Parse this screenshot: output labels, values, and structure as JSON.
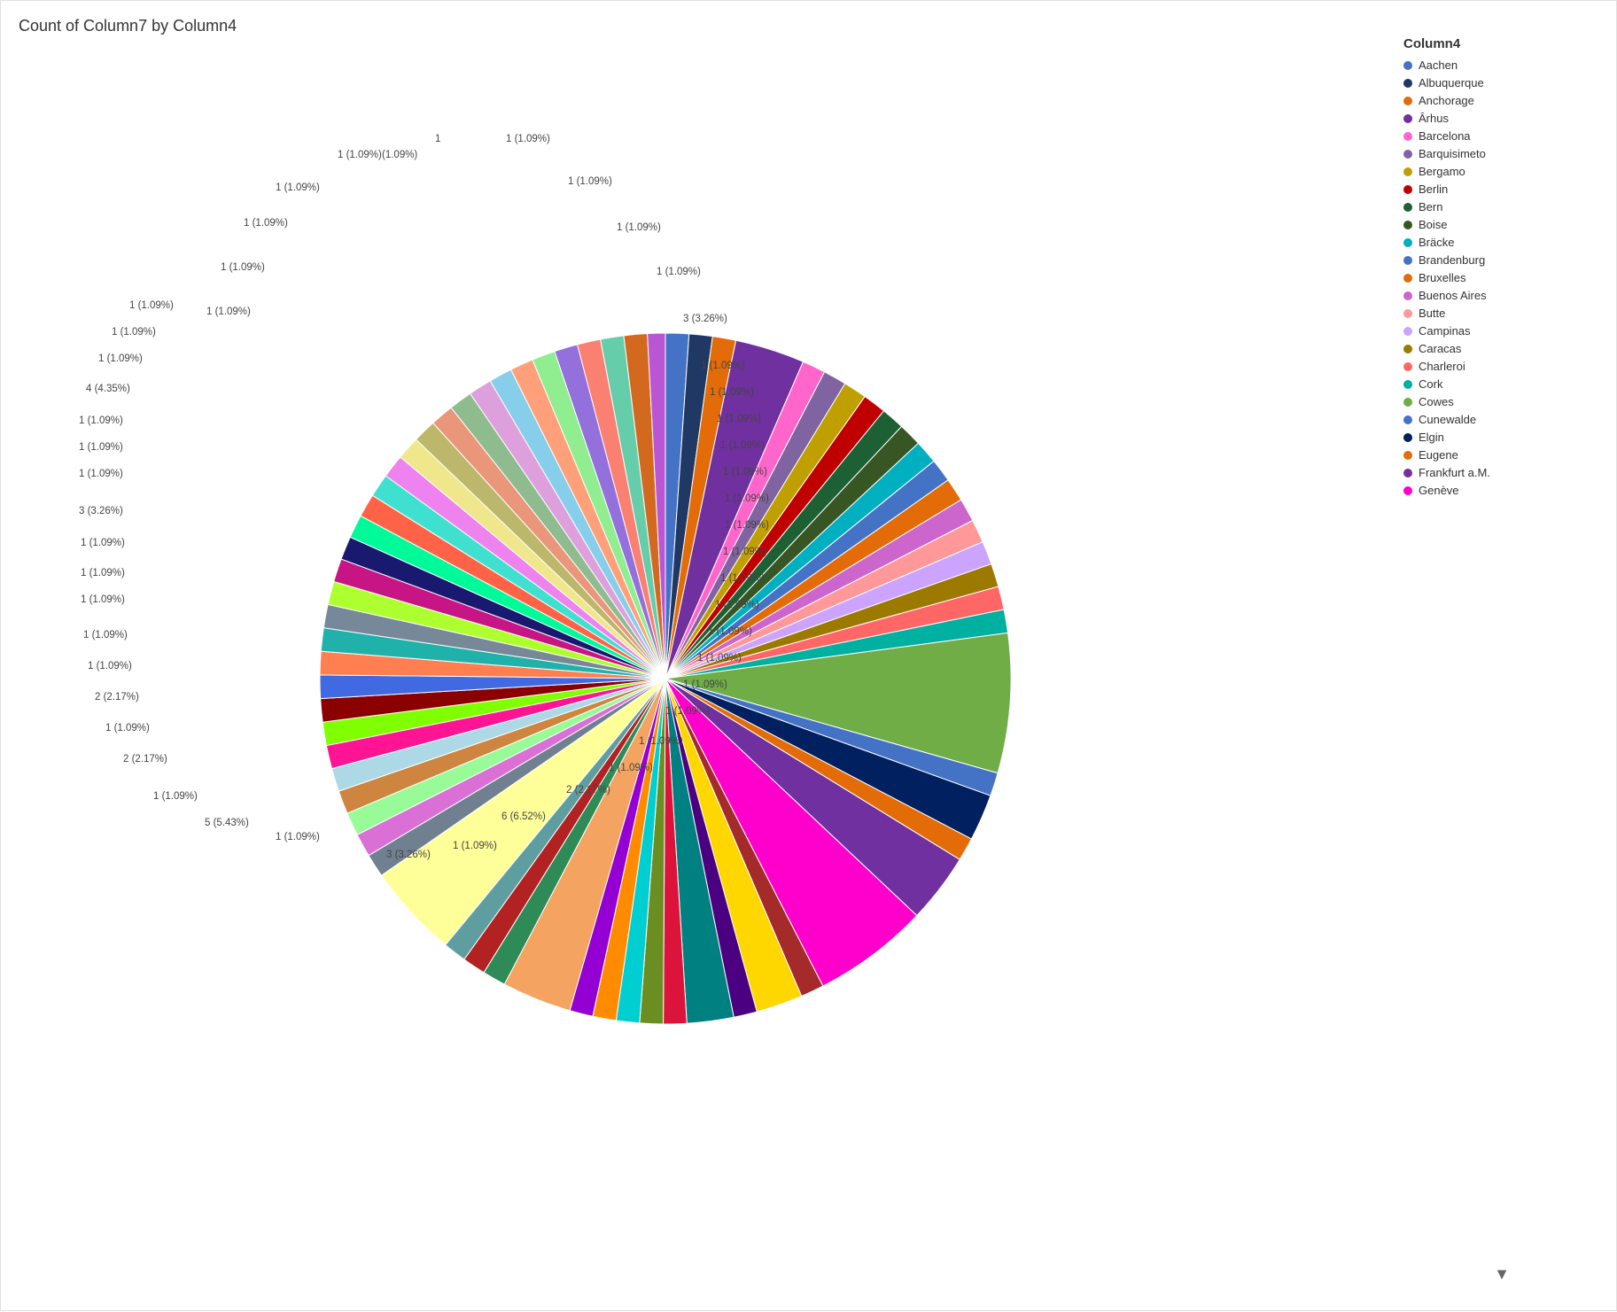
{
  "title": "Count of Column7 by Column4",
  "legend": {
    "title": "Column4",
    "items": [
      {
        "label": "Aachen",
        "color": "#4472C4"
      },
      {
        "label": "Albuquerque",
        "color": "#1F3864"
      },
      {
        "label": "Anchorage",
        "color": "#E36C09"
      },
      {
        "label": "Ārhus",
        "color": "#7030A0"
      },
      {
        "label": "Barcelona",
        "color": "#FF66CC"
      },
      {
        "label": "Barquisimeto",
        "color": "#8064A2"
      },
      {
        "label": "Bergamo",
        "color": "#C0A000"
      },
      {
        "label": "Berlin",
        "color": "#C00000"
      },
      {
        "label": "Bern",
        "color": "#1D6033"
      },
      {
        "label": "Boise",
        "color": "#375623"
      },
      {
        "label": "Bräcke",
        "color": "#00B0C0"
      },
      {
        "label": "Brandenburg",
        "color": "#4472C4"
      },
      {
        "label": "Bruxelles",
        "color": "#E36C09"
      },
      {
        "label": "Buenos Aires",
        "color": "#CC66CC"
      },
      {
        "label": "Butte",
        "color": "#FF9999"
      },
      {
        "label": "Campinas",
        "color": "#CCA3FF"
      },
      {
        "label": "Caracas",
        "color": "#9C7A00"
      },
      {
        "label": "Charleroi",
        "color": "#FF6666"
      },
      {
        "label": "Cork",
        "color": "#00B0A0"
      },
      {
        "label": "Cowes",
        "color": "#70AD47"
      },
      {
        "label": "Cunewalde",
        "color": "#4472C4"
      },
      {
        "label": "Elgin",
        "color": "#002060"
      },
      {
        "label": "Eugene",
        "color": "#E36C09"
      },
      {
        "label": "Frankfurt a.M.",
        "color": "#7030A0"
      },
      {
        "label": "Genève",
        "color": "#FF00CC"
      }
    ]
  },
  "slices": [
    {
      "label": "1 (1.09%)",
      "color": "#4472C4",
      "startAngle": 0,
      "endAngle": 3.927
    },
    {
      "label": "1 (1.09%)",
      "color": "#1F3864",
      "startAngle": 3.927,
      "endAngle": 7.854
    },
    {
      "label": "1 (1.09%)",
      "color": "#E36C09",
      "startAngle": 7.854,
      "endAngle": 11.781
    },
    {
      "label": "3 (3.26%)",
      "color": "#7030A0",
      "startAngle": 11.781,
      "endAngle": 23.491
    },
    {
      "label": "1 (1.09%)",
      "color": "#FF66CC",
      "startAngle": 23.491,
      "endAngle": 27.418
    },
    {
      "label": "1 (1.09%)",
      "color": "#8064A2",
      "startAngle": 27.418,
      "endAngle": 31.345
    },
    {
      "label": "1 (1.09%)",
      "color": "#C0A000",
      "startAngle": 31.345,
      "endAngle": 35.272
    },
    {
      "label": "1 (1.09%)",
      "color": "#C00000",
      "startAngle": 35.272,
      "endAngle": 39.199
    },
    {
      "label": "1 (1.09%)",
      "color": "#1D6033",
      "startAngle": 39.199,
      "endAngle": 43.126
    },
    {
      "label": "1 (1.09%)",
      "color": "#375623",
      "startAngle": 43.126,
      "endAngle": 47.053
    },
    {
      "label": "1 (1.09%)",
      "color": "#00B0C0",
      "startAngle": 47.053,
      "endAngle": 50.98
    },
    {
      "label": "1 (1.09%)",
      "color": "#4472C4",
      "startAngle": 50.98,
      "endAngle": 54.907
    },
    {
      "label": "1 (1.09%)",
      "color": "#E36C09",
      "startAngle": 54.907,
      "endAngle": 58.834
    },
    {
      "label": "1 (1.09%)",
      "color": "#CC66CC",
      "startAngle": 58.834,
      "endAngle": 62.761
    },
    {
      "label": "1 (1.09%)",
      "color": "#FF9999",
      "startAngle": 62.761,
      "endAngle": 66.688
    },
    {
      "label": "1 (1.09%)",
      "color": "#CCA3FF",
      "startAngle": 66.688,
      "endAngle": 70.615
    },
    {
      "label": "1 (1.09%)",
      "color": "#9C7A00",
      "startAngle": 70.615,
      "endAngle": 74.542
    },
    {
      "label": "1 (1.09%)",
      "color": "#FF6666",
      "startAngle": 74.542,
      "endAngle": 78.469
    },
    {
      "label": "1 (1.09%)",
      "color": "#00B0A0",
      "startAngle": 78.469,
      "endAngle": 82.396
    },
    {
      "label": "6 (6.52%)",
      "color": "#70AD47",
      "startAngle": 82.396,
      "endAngle": 105.887
    },
    {
      "label": "1 (1.09%)",
      "color": "#4472C4",
      "startAngle": 105.887,
      "endAngle": 109.814
    },
    {
      "label": "2 (2.17%)",
      "color": "#002060",
      "startAngle": 109.814,
      "endAngle": 117.668
    },
    {
      "label": "1 (1.09%)",
      "color": "#E36C09",
      "startAngle": 117.668,
      "endAngle": 121.595
    },
    {
      "label": "3 (3.26%)",
      "color": "#7030A0",
      "startAngle": 121.595,
      "endAngle": 133.305
    },
    {
      "label": "5 (5.43%)",
      "color": "#FF00CC",
      "startAngle": 133.305,
      "endAngle": 152.868
    },
    {
      "label": "1 (1.09%)",
      "color": "#A52A2A",
      "startAngle": 152.868,
      "endAngle": 156.795
    },
    {
      "label": "2 (2.17%)",
      "color": "#FFD700",
      "startAngle": 156.795,
      "endAngle": 164.649
    },
    {
      "label": "1 (1.09%)",
      "color": "#4B0082",
      "startAngle": 164.649,
      "endAngle": 168.576
    },
    {
      "label": "2 (2.17%)",
      "color": "#008080",
      "startAngle": 168.576,
      "endAngle": 176.43
    },
    {
      "label": "1 (1.09%)",
      "color": "#DC143C",
      "startAngle": 176.43,
      "endAngle": 180.357
    },
    {
      "label": "1 (1.09%)",
      "color": "#6B8E23",
      "startAngle": 180.357,
      "endAngle": 184.284
    },
    {
      "label": "1 (1.09%)",
      "color": "#00CED1",
      "startAngle": 184.284,
      "endAngle": 188.211
    },
    {
      "label": "1 (1.09%)",
      "color": "#FF8C00",
      "startAngle": 188.211,
      "endAngle": 192.138
    },
    {
      "label": "1 (1.09%)",
      "color": "#9400D3",
      "startAngle": 192.138,
      "endAngle": 196.065
    },
    {
      "label": "3 (3.26%)",
      "color": "#F4A460",
      "startAngle": 196.065,
      "endAngle": 207.775
    },
    {
      "label": "1 (1.09%)",
      "color": "#2E8B57",
      "startAngle": 207.775,
      "endAngle": 211.702
    },
    {
      "label": "1 (1.09%)",
      "color": "#B22222",
      "startAngle": 211.702,
      "endAngle": 215.629
    },
    {
      "label": "1 (1.09%)",
      "color": "#5F9EA0",
      "startAngle": 215.629,
      "endAngle": 219.556
    },
    {
      "label": "4 (4.35%)",
      "color": "#FFFF99",
      "startAngle": 219.556,
      "endAngle": 235.266
    },
    {
      "label": "1 (1.09%)",
      "color": "#708090",
      "startAngle": 235.266,
      "endAngle": 239.193
    },
    {
      "label": "1 (1.09%)",
      "color": "#DA70D6",
      "startAngle": 239.193,
      "endAngle": 243.12
    },
    {
      "label": "1 (1.09%)",
      "color": "#98FB98",
      "startAngle": 243.12,
      "endAngle": 247.047
    },
    {
      "label": "1 (1.09%)",
      "color": "#CD853F",
      "startAngle": 247.047,
      "endAngle": 250.974
    },
    {
      "label": "1 (1.09%)",
      "color": "#ADD8E6",
      "startAngle": 250.974,
      "endAngle": 254.901
    },
    {
      "label": "1 (1.09%)",
      "color": "#FF1493",
      "startAngle": 254.901,
      "endAngle": 258.828
    },
    {
      "label": "1 (1.09%)",
      "color": "#7FFF00",
      "startAngle": 258.828,
      "endAngle": 262.755
    },
    {
      "label": "1 (1.09%)",
      "color": "#8B0000",
      "startAngle": 262.755,
      "endAngle": 266.682
    },
    {
      "label": "1 (1.09%)",
      "color": "#4169E1",
      "startAngle": 266.682,
      "endAngle": 270.609
    },
    {
      "label": "1 (1.09%)",
      "color": "#FF7F50",
      "startAngle": 270.609,
      "endAngle": 274.536
    },
    {
      "label": "1 (1.09%)",
      "color": "#20B2AA",
      "startAngle": 274.536,
      "endAngle": 278.463
    },
    {
      "label": "1 (1.09%)",
      "color": "#778899",
      "startAngle": 278.463,
      "endAngle": 282.39
    },
    {
      "label": "1 (1.09%)",
      "color": "#ADFF2F",
      "startAngle": 282.39,
      "endAngle": 286.317
    },
    {
      "label": "1 (1.09%)",
      "color": "#C71585",
      "startAngle": 286.317,
      "endAngle": 290.244
    },
    {
      "label": "1 (1.09%)",
      "color": "#191970",
      "startAngle": 290.244,
      "endAngle": 294.171
    },
    {
      "label": "1 (1.09%)",
      "color": "#00FA9A",
      "startAngle": 294.171,
      "endAngle": 298.098
    },
    {
      "label": "1 (1.09%)",
      "color": "#FF6347",
      "startAngle": 298.098,
      "endAngle": 302.025
    },
    {
      "label": "1 (1.09%)",
      "color": "#40E0D0",
      "startAngle": 302.025,
      "endAngle": 305.952
    },
    {
      "label": "1 (1.09%)",
      "color": "#EE82EE",
      "startAngle": 305.952,
      "endAngle": 309.879
    },
    {
      "label": "1 (1.09%)",
      "color": "#F0E68C",
      "startAngle": 309.879,
      "endAngle": 313.806
    },
    {
      "label": "1 (1.09%)",
      "color": "#BDB76B",
      "startAngle": 313.806,
      "endAngle": 317.733
    },
    {
      "label": "1 (1.09%)",
      "color": "#E9967A",
      "startAngle": 317.733,
      "endAngle": 321.66
    },
    {
      "label": "1 (1.09%)",
      "color": "#8FBC8F",
      "startAngle": 321.66,
      "endAngle": 325.587
    },
    {
      "label": "1 (1.09%)",
      "color": "#DDA0DD",
      "startAngle": 325.587,
      "endAngle": 329.514
    },
    {
      "label": "1 (1.09%)",
      "color": "#87CEEB",
      "startAngle": 329.514,
      "endAngle": 333.441
    },
    {
      "label": "1 (1.09%)",
      "color": "#FFA07A",
      "startAngle": 333.441,
      "endAngle": 337.368
    },
    {
      "label": "1 (1.09%)",
      "color": "#90EE90",
      "startAngle": 337.368,
      "endAngle": 341.295
    },
    {
      "label": "1 (1.09%)",
      "color": "#9370DB",
      "startAngle": 341.295,
      "endAngle": 345.222
    },
    {
      "label": "1 (1.09%)",
      "color": "#FA8072",
      "startAngle": 345.222,
      "endAngle": 349.149
    },
    {
      "label": "1 (1.09%)",
      "color": "#66CDAA",
      "startAngle": 349.149,
      "endAngle": 353.076
    },
    {
      "label": "1 (1.09%)",
      "color": "#D2691E",
      "startAngle": 353.076,
      "endAngle": 357.003
    },
    {
      "label": "1 (1.09%)",
      "color": "#BA55D3",
      "startAngle": 357.003,
      "endAngle": 360
    }
  ]
}
